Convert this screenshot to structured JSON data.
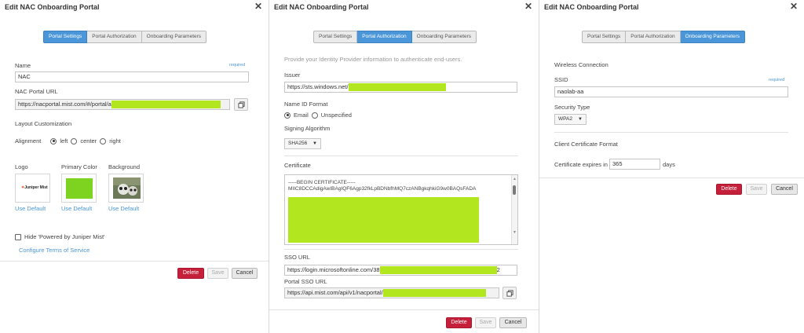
{
  "dialogs": {
    "portal_settings": {
      "title": "Edit NAC Onboarding Portal",
      "tabs": [
        "Portal Settings",
        "Portal Authorization",
        "Onboarding Parameters"
      ],
      "name_label": "Name",
      "name_required": "required",
      "name_value": "NAC",
      "url_label": "NAC Portal URL",
      "url_value": "https://nacportal.mist.com/#/portal/a",
      "layout_heading": "Layout Customization",
      "alignment_label": "Alignment",
      "alignment_options": [
        "left",
        "center",
        "right"
      ],
      "logo_label": "Logo",
      "primary_color_label": "Primary Color",
      "background_label": "Background",
      "logo_text": "Juniper Mist",
      "use_default": "Use Default",
      "primary_color": "#7ed321",
      "hide_powered": "Hide 'Powered by Juniper Mist'",
      "terms_link": "Configure Terms of Service",
      "buttons": {
        "delete": "Delete",
        "save": "Save",
        "cancel": "Cancel"
      }
    },
    "portal_auth": {
      "title": "Edit NAC Onboarding Portal",
      "tabs": [
        "Portal Settings",
        "Portal Authorization",
        "Onboarding Parameters"
      ],
      "intro": "Provide your Identity Provider information to authenticate end-users.",
      "issuer_label": "Issuer",
      "issuer_value": "https://sts.windows.net/",
      "nameid_label": "Name ID Format",
      "nameid_options": [
        "Email",
        "Unspecified"
      ],
      "signing_label": "Signing Algorithm",
      "signing_value": "SHA256",
      "cert_label": "Certificate",
      "cert_line1": "-----BEGIN CERTIFICATE-----",
      "cert_line2": "MIIC8DCCAdigAwIBAgIQF6Agp32fkLpBDNbfhMQ7czANBgkqhkiG9w0BAQsFADA",
      "sso_label": "SSO URL",
      "sso_value": "https://login.microsoftonline.com/38",
      "sso_suffix": "2",
      "portal_sso_label": "Portal SSO URL",
      "portal_sso_value": "https://api.mist.com/api/v1/nacportal/",
      "buttons": {
        "delete": "Delete",
        "save": "Save",
        "cancel": "Cancel"
      }
    },
    "onboarding": {
      "title": "Edit NAC Onboarding Portal",
      "tabs": [
        "Portal Settings",
        "Portal Authorization",
        "Onboarding Parameters"
      ],
      "wireless_heading": "Wireless Connection",
      "ssid_label": "SSID",
      "ssid_required": "required",
      "ssid_value": "naolab-aa",
      "security_label": "Security Type",
      "security_value": "WPA2",
      "cert_format_heading": "Client Certificate Format",
      "expires_label": "Certificate expires in",
      "expires_value": "365",
      "expires_unit": "days",
      "buttons": {
        "delete": "Delete",
        "save": "Save",
        "cancel": "Cancel"
      }
    }
  },
  "colors": {
    "accent": "#4a96d8",
    "delete": "#c61f3a",
    "redaction": "#b2e61e"
  },
  "icons": [
    "close-icon",
    "copy-icon",
    "dropdown-caret-icon"
  ]
}
